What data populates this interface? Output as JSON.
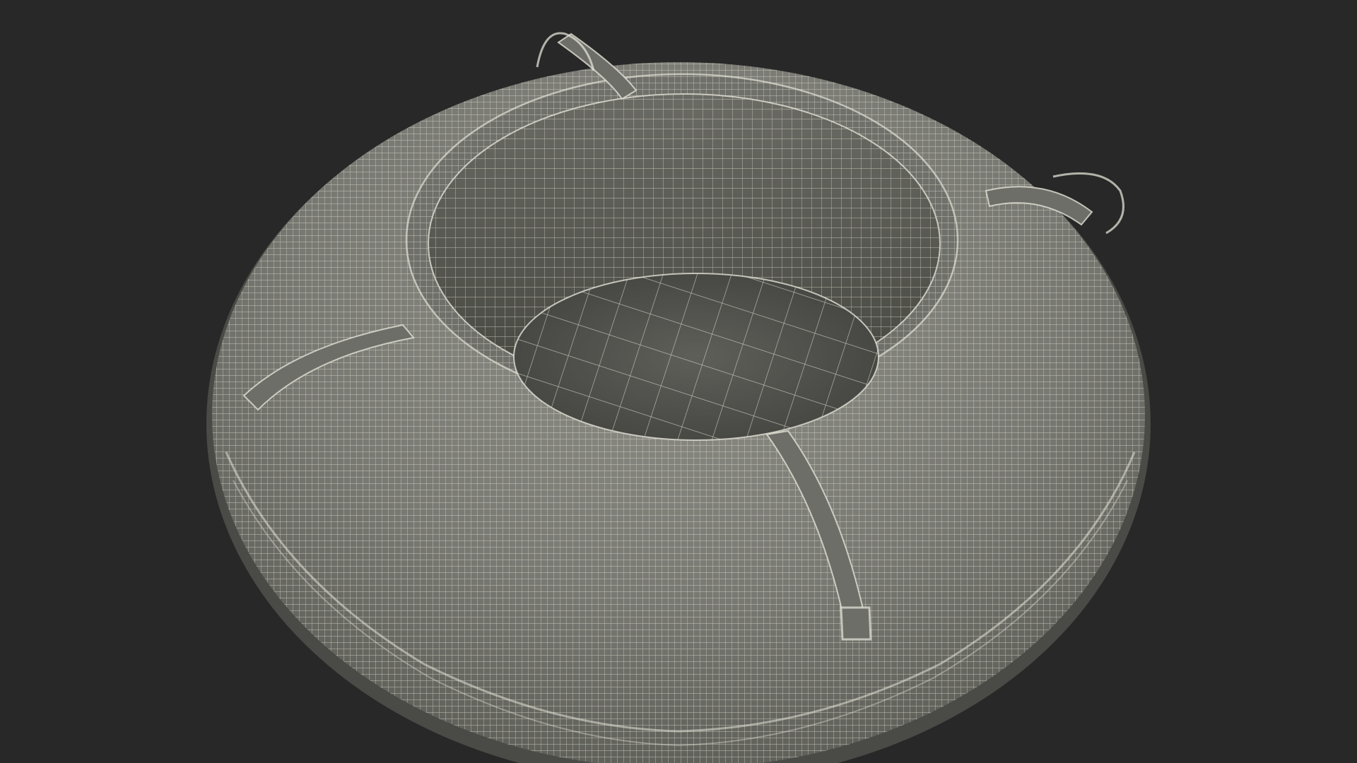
{
  "scene": {
    "subject": "wireframe-snow-tube-render",
    "colors": {
      "background": "#282828",
      "surface_light": "#8a8b83",
      "surface_mid": "#6e6f68",
      "surface_dark": "#4d4e49",
      "inner_floor": "#5c5d58",
      "hole_shadow": "#3c3d39",
      "wire": "#e2e1d6"
    },
    "icons": {
      "handles": "strap-handle-icon",
      "straps": "strap-band-icon"
    }
  }
}
